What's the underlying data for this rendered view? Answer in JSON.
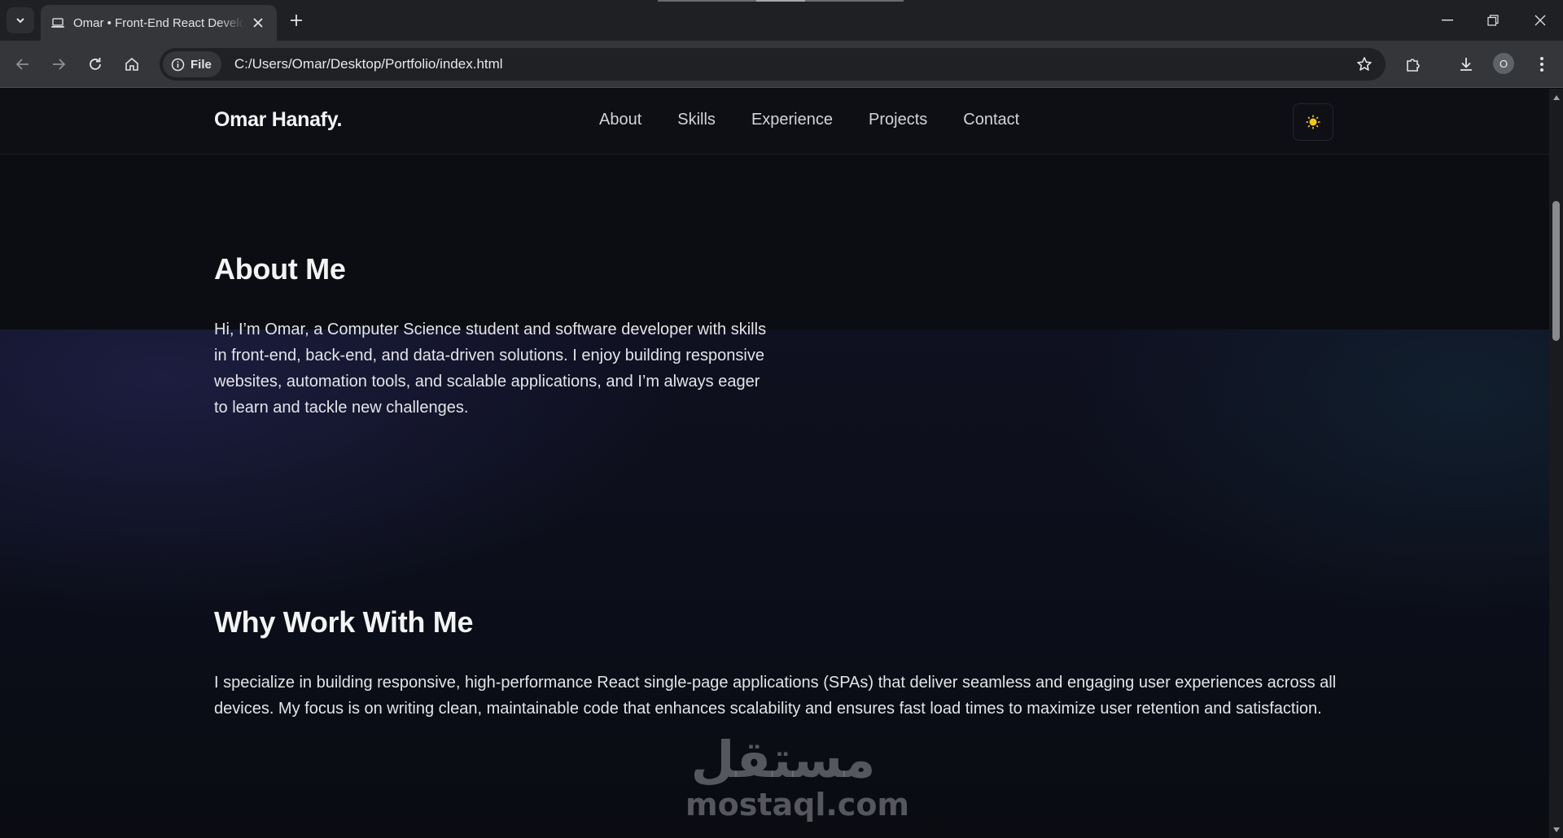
{
  "browser": {
    "tab_title": "Omar • Front-End React Developer",
    "new_tab_symbol": "+",
    "file_chip_label": "File",
    "url": "C:/Users/Omar/Desktop/Portfolio/index.html",
    "profile_initial": "O"
  },
  "site": {
    "logo": "Omar Hanafy",
    "logo_dot": ".",
    "nav": [
      "About",
      "Skills",
      "Experience",
      "Projects",
      "Contact"
    ],
    "theme_toggle_icon": "sun-icon",
    "accent_color": "#f5c518"
  },
  "about": {
    "title": "About Me",
    "body": "Hi, I’m Omar, a Computer Science student and software developer with skills in front-end, back-end, and data-driven solutions. I enjoy building responsive websites, automation tools, and scalable applications, and I’m always eager to learn and tackle new challenges."
  },
  "why": {
    "title": "Why Work With Me",
    "body": "I specialize in building responsive, high-performance React single-page applications (SPAs) that deliver seamless and engaging user experiences across all devices. My focus is on writing clean, maintainable code that enhances scalability and ensures fast load times to maximize user retention and satisfaction."
  },
  "watermark": {
    "arabic": "مستقل",
    "latin": "mostaql.com"
  }
}
